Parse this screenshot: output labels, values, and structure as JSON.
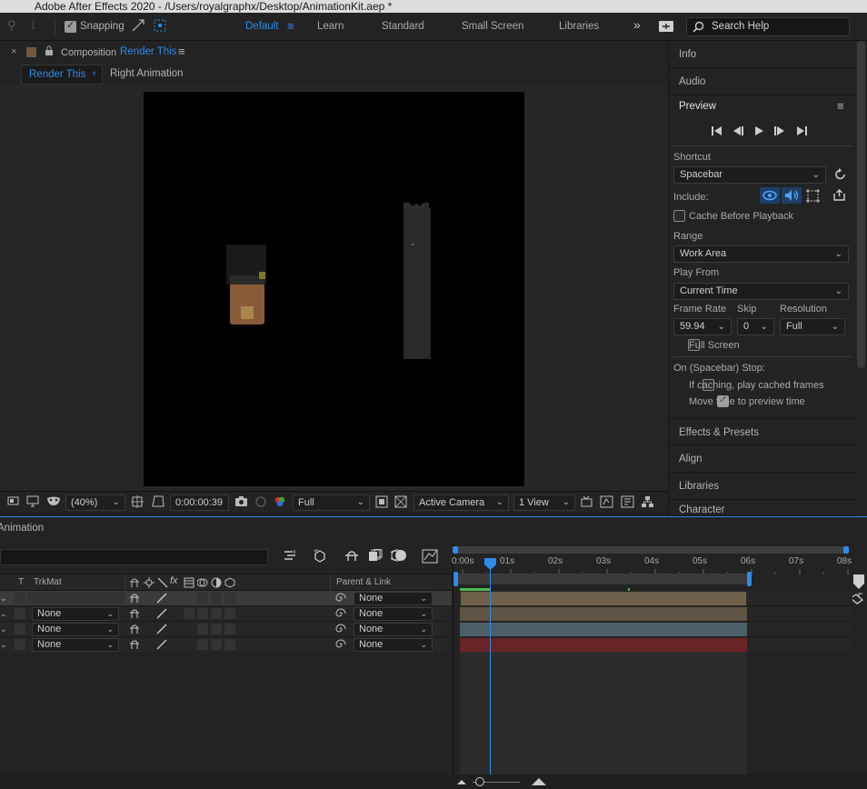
{
  "titlebar": {
    "title": "Adobe After Effects 2020 - /Users/royalgraphx/Desktop/AnimationKit.aep *"
  },
  "toolbar": {
    "snapping_label": "Snapping",
    "snapping_checked": true,
    "workspaces": [
      "Default",
      "Learn",
      "Standard",
      "Small Screen",
      "Libraries"
    ],
    "active_workspace": "Default",
    "search_placeholder": "Search Help"
  },
  "composition": {
    "panel_prefix": "Composition",
    "panel_name": "Render This",
    "tabs": [
      "Render This",
      "Right Animation"
    ],
    "footer": {
      "zoom": "(40%)",
      "timecode": "0:00:00:39",
      "resolution": "Full",
      "camera": "Active Camera",
      "views": "1 View"
    }
  },
  "right_panel": {
    "collapsed_top": [
      "Info",
      "Audio"
    ],
    "preview": {
      "title": "Preview",
      "shortcut_label": "Shortcut",
      "shortcut_value": "Spacebar",
      "include_label": "Include:",
      "cache_before_playback": "Cache Before Playback",
      "range_label": "Range",
      "range_value": "Work Area",
      "play_from_label": "Play From",
      "play_from_value": "Current Time",
      "frame_rate_label": "Frame Rate",
      "skip_label": "Skip",
      "resolution_label": "Resolution",
      "frame_rate_value": "59.94",
      "skip_value": "0",
      "resolution_value": "Full",
      "full_screen": "Full Screen",
      "stop_label": "On (Spacebar) Stop:",
      "if_caching": "If caching, play cached frames",
      "move_time": "Move time to preview time"
    },
    "collapsed_bottom": [
      "Effects & Presets",
      "Align",
      "Libraries",
      "Character"
    ]
  },
  "timeline": {
    "title": "Animation",
    "columns": {
      "t": "T",
      "trkmat": "TrkMat",
      "parent_link": "Parent & Link"
    },
    "layers": [
      {
        "trkmat": "",
        "parent": "None"
      },
      {
        "trkmat": "None",
        "parent": "None"
      },
      {
        "trkmat": "None",
        "parent": "None"
      },
      {
        "trkmat": "None",
        "parent": "None"
      }
    ],
    "ruler": [
      "0:00s",
      "01s",
      "02s",
      "03s",
      "04s",
      "05s",
      "06s",
      "07s",
      "08s"
    ],
    "track_colors": [
      "#6e5f48",
      "#5d5445",
      "#4d5f66",
      "#6a2327"
    ]
  }
}
